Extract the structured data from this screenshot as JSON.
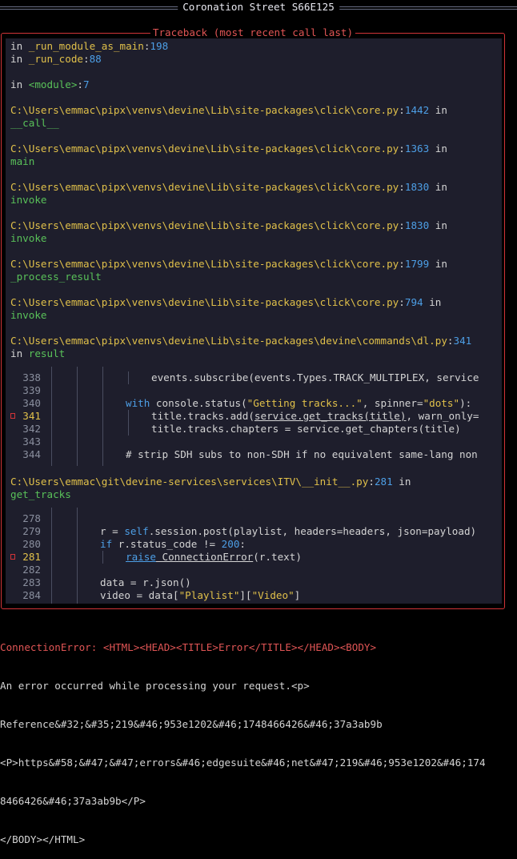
{
  "window": {
    "title": "Coronation Street S66E125"
  },
  "traceback": {
    "title": "Traceback (most recent call last)",
    "frames_top": [
      {
        "pre": "in ",
        "fn": "_run_module_as_main",
        "sep": ":",
        "lineno": "198"
      },
      {
        "pre": "in ",
        "fn": "_run_code",
        "sep": ":",
        "lineno": "88"
      },
      {
        "pre": "in ",
        "fn": "<module>",
        "sep": ":",
        "lineno": "7"
      }
    ],
    "frames": [
      {
        "path": "C:\\Users\\emmac\\pipx\\venvs\\devine\\Lib\\site-packages\\click\\core.py",
        "lineno": "1442",
        "in": " in",
        "fn": "__call__"
      },
      {
        "path": "C:\\Users\\emmac\\pipx\\venvs\\devine\\Lib\\site-packages\\click\\core.py",
        "lineno": "1363",
        "in": " in",
        "fn": "main"
      },
      {
        "path": "C:\\Users\\emmac\\pipx\\venvs\\devine\\Lib\\site-packages\\click\\core.py",
        "lineno": "1830",
        "in": " in",
        "fn": "invoke"
      },
      {
        "path": "C:\\Users\\emmac\\pipx\\venvs\\devine\\Lib\\site-packages\\click\\core.py",
        "lineno": "1830",
        "in": " in",
        "fn": "invoke"
      },
      {
        "path": "C:\\Users\\emmac\\pipx\\venvs\\devine\\Lib\\site-packages\\click\\core.py",
        "lineno": "1799",
        "in": " in",
        "fn": "_process_result"
      },
      {
        "path": "C:\\Users\\emmac\\pipx\\venvs\\devine\\Lib\\site-packages\\click\\core.py",
        "lineno": "794",
        "in": " in",
        "fn": "invoke"
      },
      {
        "path": "C:\\Users\\emmac\\pipx\\venvs\\devine\\Lib\\site-packages\\devine\\commands\\dl.py",
        "lineno": "341",
        "in": "in ",
        "fn": "result"
      }
    ],
    "code1": [
      {
        "num": "338",
        "text": "events.subscribe(events.Types.TRACK_MULTIPLEX, service"
      },
      {
        "num": "339",
        "text": ""
      },
      {
        "num": "340",
        "kw": "with",
        "text": " console.status(",
        "str": "\"Getting tracks...\"",
        "rest": ", spinner=",
        "str2": "\"dots\"",
        "end": "):"
      },
      {
        "num": "341",
        "text": "title.tracks.add(",
        "u": "service.get_tracks(title)",
        "rest": ", warn_only=",
        "err": true
      },
      {
        "num": "342",
        "text": "title.tracks.chapters = service.get_chapters(title)"
      },
      {
        "num": "343",
        "text": ""
      },
      {
        "num": "344",
        "text": "# strip SDH subs to non-SDH if no equivalent same-lang non"
      }
    ],
    "frame2": {
      "path": "C:\\Users\\emmac\\git\\devine-services\\services\\ITV\\__init__.py",
      "lineno": "281",
      "in": " in",
      "fn": "get_tracks"
    },
    "code2": [
      {
        "num": "278",
        "text": ""
      },
      {
        "num": "279",
        "text": "r = ",
        "self": "self",
        "rest": ".session.post(playlist, headers=headers, json=payload)"
      },
      {
        "num": "280",
        "kw": "if",
        "text": " r.status_code != ",
        "n": "200",
        "end": ":"
      },
      {
        "num": "281",
        "kw": "raise",
        "u": " ConnectionError",
        "rest": "(r.text)",
        "err": true
      },
      {
        "num": "282",
        "text": ""
      },
      {
        "num": "283",
        "text": "data = r.json()"
      },
      {
        "num": "284",
        "text": "video = data[",
        "str": "\"Playlist\"",
        "mid": "][",
        "str2": "\"Video\"",
        "end": "]"
      }
    ]
  },
  "error": {
    "lines": [
      "ConnectionError: <HTML><HEAD><TITLE>Error</TITLE></HEAD><BODY>",
      "An error occurred while processing your request.<p>",
      "Reference&#32;&#35;219&#46;953e1202&#46;1748466426&#46;37a3ab9b",
      "<P>https&#58;&#47;&#47;errors&#46;edgesuite&#46;net&#47;219&#46;953e1202&#46;174",
      "8466426&#46;37a3ab9b</P>",
      "</BODY></HTML>"
    ]
  },
  "colors": {
    "border": "#d13438",
    "path": "#e0c04a",
    "lineno": "#4d9fe6",
    "func": "#59c159",
    "panel_bg": "#1e1e2c"
  }
}
